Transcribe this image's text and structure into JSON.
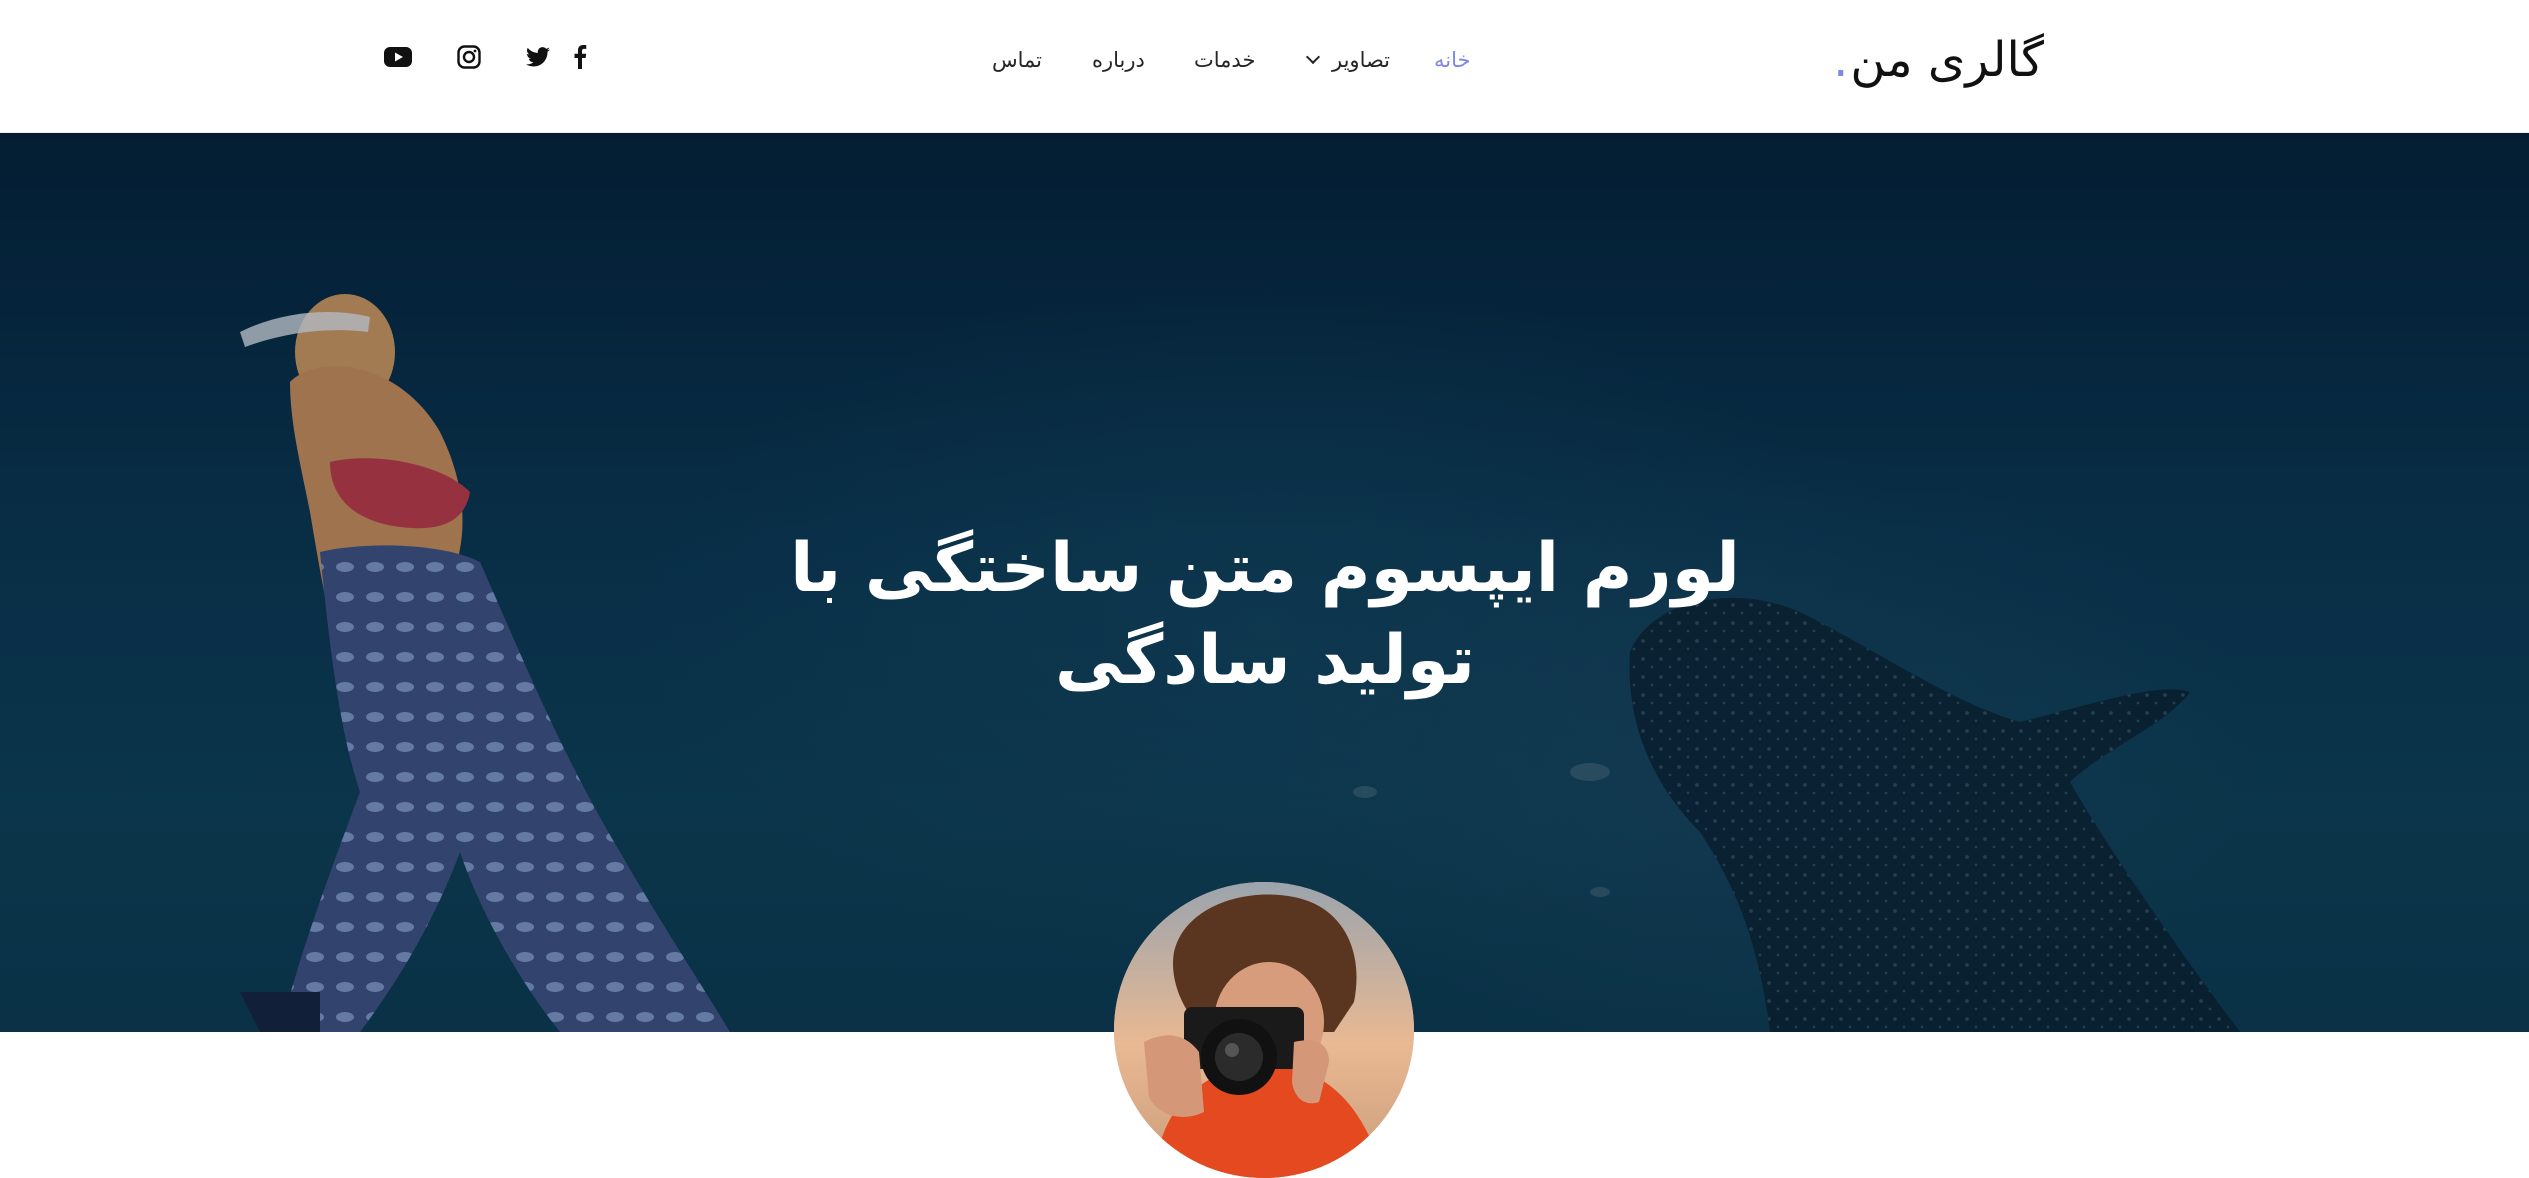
{
  "header": {
    "brand": "گالری من",
    "brand_dot": ".",
    "nav": [
      {
        "label": "خانه",
        "active": true
      },
      {
        "label": "تصاویر",
        "has_dropdown": true
      },
      {
        "label": "خدمات"
      },
      {
        "label": "درباره"
      },
      {
        "label": "تماس"
      }
    ],
    "social": [
      "facebook-icon",
      "twitter-icon",
      "instagram-icon",
      "youtube-icon"
    ],
    "accent_color": "#7f86ea"
  },
  "hero": {
    "title": "لورم ایپسوم متن ساختگی با\nتولید سادگی"
  }
}
